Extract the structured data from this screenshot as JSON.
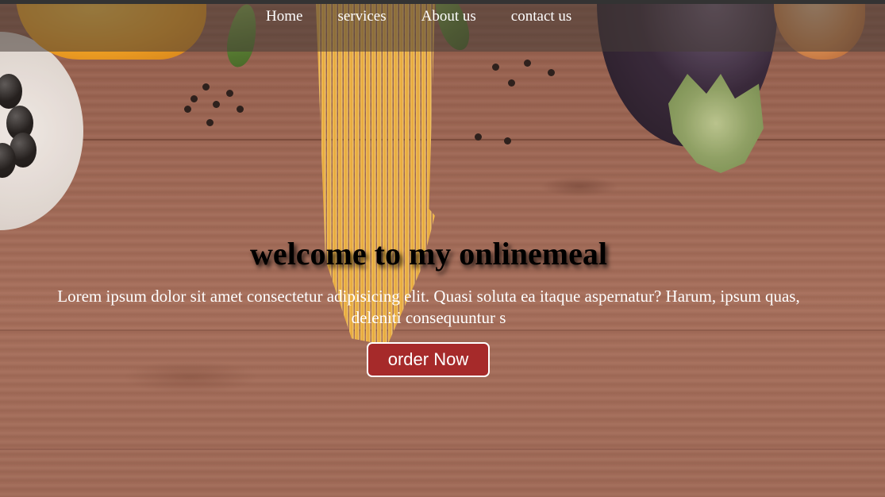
{
  "nav": {
    "items": [
      {
        "label": "Home"
      },
      {
        "label": "services"
      },
      {
        "label": "About us"
      },
      {
        "label": "contact us"
      }
    ]
  },
  "hero": {
    "title": "welcome to my onlinemeal",
    "description": "Lorem ipsum dolor sit amet consectetur adipisicing elit. Quasi soluta ea itaque aspernatur? Harum, ipsum quas, deleniti consequuntur s",
    "cta_label": "order Now",
    "cta_color": "#a62a2a"
  }
}
